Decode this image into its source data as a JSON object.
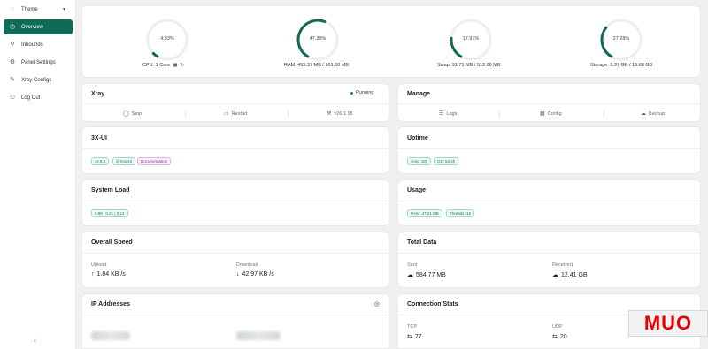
{
  "sidebar": {
    "items": [
      {
        "label": "Theme",
        "icon": "bulb-icon"
      },
      {
        "label": "Overview",
        "icon": "gauge-icon"
      },
      {
        "label": "Inbounds",
        "icon": "user-icon"
      },
      {
        "label": "Panel Settings",
        "icon": "gear-icon"
      },
      {
        "label": "Xray Configs",
        "icon": "tool-icon"
      },
      {
        "label": "Log Out",
        "icon": "logout-icon"
      }
    ],
    "collapse_glyph": "‹"
  },
  "gauges": [
    {
      "percent_text": "4.33%",
      "value": 4.33,
      "label": "CPU: 1 Core"
    },
    {
      "percent_text": "47.35%",
      "value": 47.35,
      "label": "RAM: 455.37 MB / 961.60 MB"
    },
    {
      "percent_text": "17.91%",
      "value": 17.91,
      "label": "Swap: 91.71 MB / 512.00 MB"
    },
    {
      "percent_text": "27.28%",
      "value": 27.28,
      "label": "Storage: 5.37 GB / 19.68 GB"
    }
  ],
  "xray": {
    "title": "Xray",
    "status": "Running",
    "actions": {
      "stop": "Stop",
      "restart": "Restart",
      "version": "v26.1.18"
    }
  },
  "manage": {
    "title": "Manage",
    "actions": {
      "logs": "Logs",
      "config": "Config",
      "backup": "Backup"
    }
  },
  "threexui": {
    "title": "3X-UI",
    "tags": {
      "version": "v2.8.8",
      "channel": "@XrayUI",
      "docs": "Documentation"
    }
  },
  "uptime": {
    "title": "Uptime",
    "tags": {
      "xray": "Xray: 18h",
      "os": "OS: 5d 4h"
    }
  },
  "system_load": {
    "title": "System Load",
    "tags": {
      "load": "0.88 | 0.21 | 0.14"
    }
  },
  "usage": {
    "title": "Usage",
    "tags": {
      "ram": "RAM: 47.21 MB",
      "threads": "Threads: 18"
    }
  },
  "overall_speed": {
    "title": "Overall Speed",
    "upload_label": "Upload",
    "upload_value": "1.84 KB /s",
    "download_label": "Download",
    "download_value": "42.97 KB /s"
  },
  "total_data": {
    "title": "Total Data",
    "sent_label": "Sent",
    "sent_value": "584.77 MB",
    "received_label": "Received",
    "received_value": "12.41 GB"
  },
  "ip_addresses": {
    "title": "IP Addresses"
  },
  "connection_stats": {
    "title": "Connection Stats",
    "tcp_label": "TCP",
    "tcp_value": "77",
    "udp_label": "UDP",
    "udp_value": "20"
  },
  "watermark": "MUO",
  "colors": {
    "accent": "#0f6b56",
    "gauge_track": "#eceef0"
  }
}
